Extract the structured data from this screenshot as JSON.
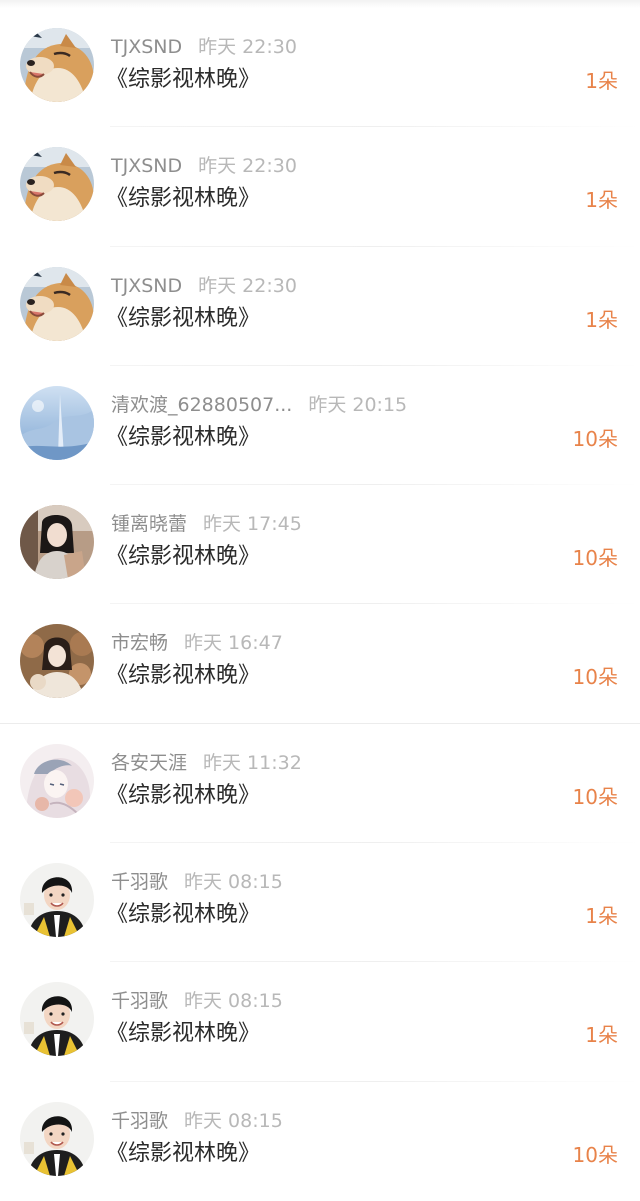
{
  "colors": {
    "amount": "#e8834a",
    "username": "#8e8e8e",
    "time": "#b8b8b8",
    "title": "#2b2b2b"
  },
  "records": [
    {
      "user": "TJXSND",
      "time": "昨天 22:30",
      "title": "《综影视林晚》",
      "amount": "1朵",
      "avatar": "shiba-dog-avatar"
    },
    {
      "user": "TJXSND",
      "time": "昨天 22:30",
      "title": "《综影视林晚》",
      "amount": "1朵",
      "avatar": "shiba-dog-avatar"
    },
    {
      "user": "TJXSND",
      "time": "昨天 22:30",
      "title": "《综影视林晚》",
      "amount": "1朵",
      "avatar": "shiba-dog-avatar"
    },
    {
      "user": "清欢渡_62880507...",
      "time": "昨天 20:15",
      "title": "《综影视林晚》",
      "amount": "10朵",
      "avatar": "blue-landscape-avatar"
    },
    {
      "user": "锺离晓蕾",
      "time": "昨天 17:45",
      "title": "《综影视林晚》",
      "amount": "10朵",
      "avatar": "girl-photo-avatar"
    },
    {
      "user": "市宏畅",
      "time": "昨天 16:47",
      "title": "《综影视林晚》",
      "amount": "10朵",
      "avatar": "girl-plush-avatar"
    },
    {
      "user": "各安天涯",
      "time": "昨天 11:32",
      "title": "《综影视林晚》",
      "amount": "10朵",
      "avatar": "illustration-avatar"
    },
    {
      "user": "千羽歌",
      "time": "昨天 08:15",
      "title": "《综影视林晚》",
      "amount": "1朵",
      "avatar": "boy-portrait-avatar"
    },
    {
      "user": "千羽歌",
      "time": "昨天 08:15",
      "title": "《综影视林晚》",
      "amount": "1朵",
      "avatar": "boy-portrait-avatar"
    },
    {
      "user": "千羽歌",
      "time": "昨天 08:15",
      "title": "《综影视林晚》",
      "amount": "10朵",
      "avatar": "boy-portrait-avatar"
    }
  ]
}
